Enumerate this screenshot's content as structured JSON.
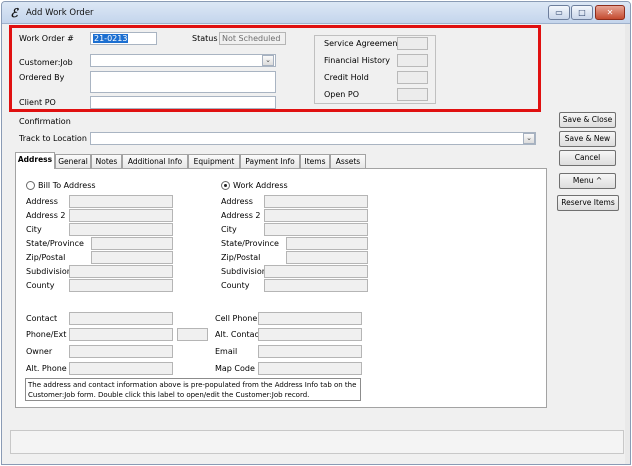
{
  "window": {
    "icon_glyph": "ℰ",
    "title": "Add Work Order",
    "minimize_glyph": "▭",
    "maximize_glyph": "□",
    "close_glyph": "✕"
  },
  "header": {
    "work_order_label": "Work Order #",
    "work_order_value": "21-0213",
    "status_label": "Status",
    "status_value": "Not Scheduled",
    "customer_job_label": "Customer:Job",
    "ordered_by_label": "Ordered By",
    "client_po_label": "Client PO",
    "confirmation_label": "Confirmation",
    "track_to_location_label": "Track to Location",
    "dropdown_glyph": "⌄"
  },
  "summary": {
    "service_agreement": "Service Agreement",
    "financial_history": "Financial History",
    "credit_hold": "Credit Hold",
    "open_po": "Open PO"
  },
  "actions": {
    "save_close": "Save & Close",
    "save_new": "Save & New",
    "cancel": "Cancel",
    "menu": "Menu ^",
    "reserve_items": "Reserve Items"
  },
  "tabs": [
    "Address",
    "General",
    "Notes",
    "Additional Info",
    "Equipment",
    "Payment Info",
    "Items",
    "Assets"
  ],
  "address_tab": {
    "bill_to_label": "Bill To Address",
    "work_address_label": "Work Address",
    "selected_address": "Work Address",
    "fields": [
      "Address",
      "Address 2",
      "City",
      "State/Province",
      "Zip/Postal",
      "Subdivision",
      "County"
    ],
    "contact_left": [
      "Contact",
      "Phone/Ext",
      "Owner",
      "Alt. Phone"
    ],
    "contact_right": [
      "Cell Phone",
      "Alt. Contact",
      "Email",
      "Map Code"
    ],
    "note_line1": "The address and contact information above is pre-populated from the Address Info tab on the",
    "note_line2": "Customer:Job form. Double click this label to open/edit the Customer:Job record."
  },
  "colors": {
    "highlight": "#e01010",
    "selection": "#1c6fd1",
    "window_bg": "#f0f0f0"
  }
}
